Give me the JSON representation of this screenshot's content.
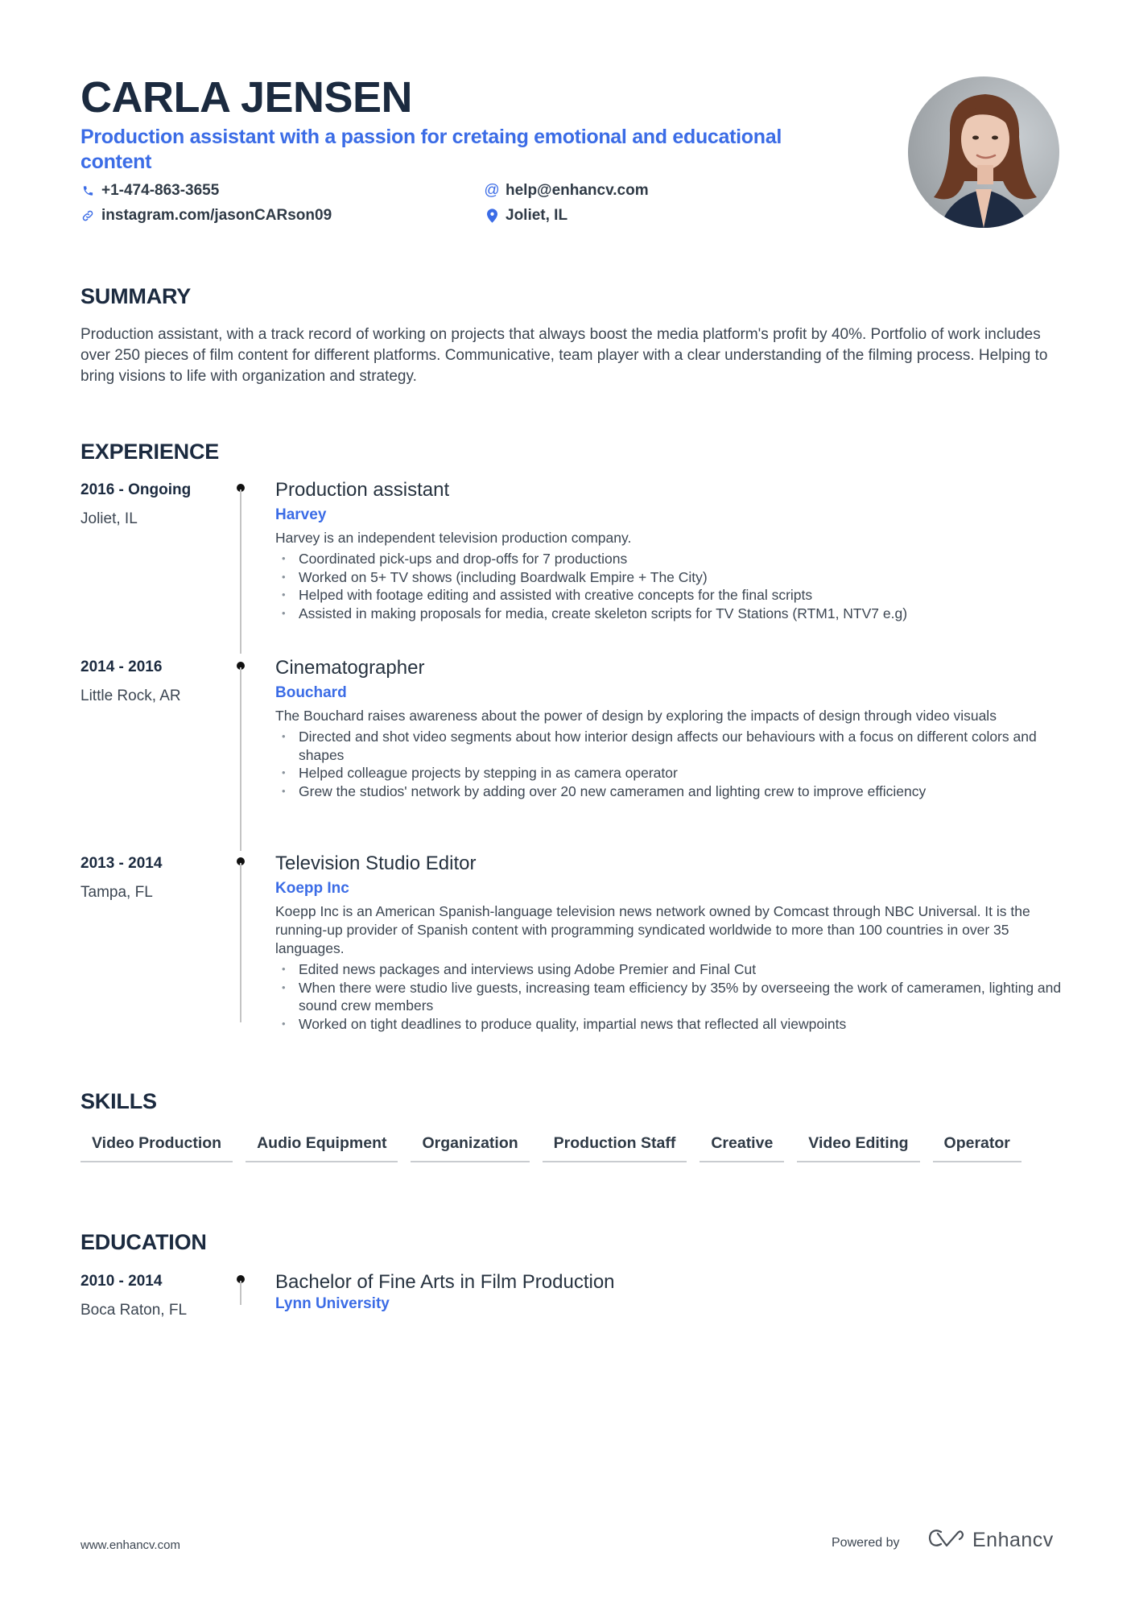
{
  "header": {
    "name": "CARLA JENSEN",
    "tagline": "Production assistant with a passion for cretaing emotional and educational content",
    "contacts": {
      "phone": {
        "icon": "phone-icon",
        "value": "+1-474-863-3655"
      },
      "email": {
        "icon": "at-icon",
        "value": "help@enhancv.com"
      },
      "link": {
        "icon": "link-icon",
        "value": "instagram.com/jasonCARson09"
      },
      "location": {
        "icon": "location-pin-icon",
        "value": "Joliet, IL"
      }
    }
  },
  "summary": {
    "title": "SUMMARY",
    "text": "Production assistant, with a track record of working on projects that always boost the media platform's profit by 40%. Portfolio of work includes over 250 pieces of film content for different platforms. Communicative, team player with a clear understanding of the filming process. Helping to bring visions to life with organization and strategy."
  },
  "experience": {
    "title": "EXPERIENCE",
    "items": [
      {
        "dates": "2016 - Ongoing",
        "location": "Joliet, IL",
        "role": "Production assistant",
        "company": "Harvey",
        "description": "Harvey is an independent television production company.",
        "bullets": [
          "Coordinated pick-ups and drop-offs for 7 productions",
          "Worked on 5+ TV shows (including Boardwalk Empire + The City)",
          "Helped with footage editing and assisted with creative concepts for the final scripts",
          "Assisted in making proposals for media, create skeleton scripts for TV Stations (RTM1, NTV7 e.g)"
        ]
      },
      {
        "dates": "2014 - 2016",
        "location": "Little Rock, AR",
        "role": "Cinematographer",
        "company": "Bouchard",
        "description": "The Bouchard raises awareness about the power of design by exploring the impacts of design through video visuals",
        "bullets": [
          "Directed and shot video segments about how interior design affects our behaviours with a focus on different colors and shapes",
          "Helped colleague projects by stepping in as camera operator",
          "Grew the studios' network by adding over 20 new cameramen and lighting crew to improve efficiency"
        ]
      },
      {
        "dates": "2013 - 2014",
        "location": "Tampa, FL",
        "role": "Television Studio Editor",
        "company": "Koepp Inc",
        "description": "Koepp Inc is an American Spanish-language television news network owned by Comcast through NBC Universal. It is the running-up provider of Spanish content with programming syndicated worldwide to more than 100 countries in over 35 languages.",
        "bullets": [
          "Edited news packages and interviews using Adobe Premier and Final Cut",
          "When there were studio live guests, increasing team efficiency by 35% by overseeing the work of cameramen, lighting and sound crew members",
          "Worked on tight deadlines to produce quality, impartial news that reflected all viewpoints"
        ]
      }
    ]
  },
  "skills": {
    "title": "SKILLS",
    "items": [
      "Video Production",
      "Audio Equipment",
      "Organization",
      "Production Staff",
      "Creative",
      "Video Editing",
      "Operator"
    ]
  },
  "education": {
    "title": "EDUCATION",
    "items": [
      {
        "dates": "2010 - 2014",
        "location": "Boca Raton, FL",
        "degree": "Bachelor of Fine Arts in Film Production",
        "school": "Lynn University"
      }
    ]
  },
  "footer": {
    "url": "www.enhancv.com",
    "powered_by": "Powered by",
    "brand": "Enhancv"
  },
  "colors": {
    "accent": "#3b6ce6",
    "heading": "#1b2a3f",
    "body": "#3c4652"
  }
}
